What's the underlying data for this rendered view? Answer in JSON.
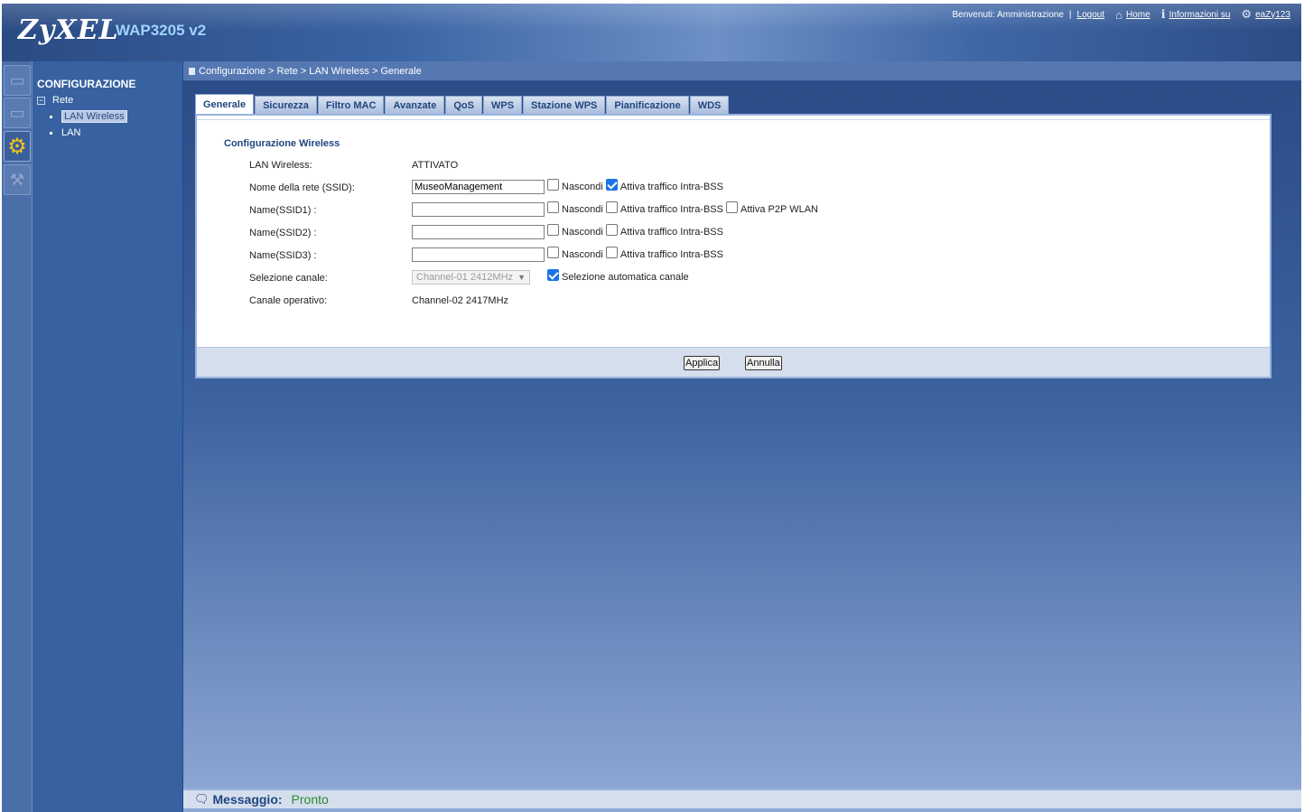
{
  "header": {
    "logo": "ZyXEL",
    "model": "WAP3205 v2",
    "welcome": "Benvenuti: Amministrazione",
    "separator": "|",
    "logout": "Logout",
    "home": "Home",
    "info": "Informazioni su",
    "easy": "eaZy123"
  },
  "nav": {
    "title": "CONFIGURAZIONE",
    "tree_toggle": "−",
    "group": "Rete",
    "items": [
      {
        "label": "LAN Wireless",
        "selected": true
      },
      {
        "label": "LAN",
        "selected": false
      }
    ]
  },
  "breadcrumb": "Configurazione > Rete > LAN Wireless > Generale",
  "tabs": [
    {
      "label": "Generale",
      "active": true
    },
    {
      "label": "Sicurezza"
    },
    {
      "label": "Filtro MAC"
    },
    {
      "label": "Avanzate"
    },
    {
      "label": "QoS"
    },
    {
      "label": "WPS"
    },
    {
      "label": "Stazione WPS"
    },
    {
      "label": "Pianificazione"
    },
    {
      "label": "WDS"
    }
  ],
  "form": {
    "section_title": "Configurazione Wireless",
    "wireless_lan": {
      "label": "LAN Wireless:",
      "value": "ATTIVATO"
    },
    "ssid": {
      "label": "Nome della rete (SSID):",
      "value": "MuseoManagement",
      "hide": "Nascondi",
      "hide_checked": false,
      "intra": "Attiva traffico Intra-BSS",
      "intra_checked": true
    },
    "ssid1": {
      "label": "Name(SSID1) :",
      "value": "",
      "hide": "Nascondi",
      "intra": "Attiva traffico Intra-BSS",
      "p2p": "Attiva P2P WLAN"
    },
    "ssid2": {
      "label": "Name(SSID2) :",
      "value": "",
      "hide": "Nascondi",
      "intra": "Attiva traffico Intra-BSS"
    },
    "ssid3": {
      "label": "Name(SSID3) :",
      "value": "",
      "hide": "Nascondi",
      "intra": "Attiva traffico Intra-BSS"
    },
    "channel": {
      "label": "Selezione canale:",
      "value": "Channel-01 2412MHz",
      "auto": "Selezione automatica canale",
      "auto_checked": true
    },
    "operating": {
      "label": "Canale operativo:",
      "value": "Channel-02 2417MHz"
    }
  },
  "buttons": {
    "apply": "Applica",
    "cancel": "Annulla"
  },
  "status": {
    "label": "Messaggio:",
    "value": "Pronto"
  },
  "colors": {
    "accent": "#21467f",
    "status_ok": "#2c8a2c",
    "frame": "#2f4f86"
  }
}
